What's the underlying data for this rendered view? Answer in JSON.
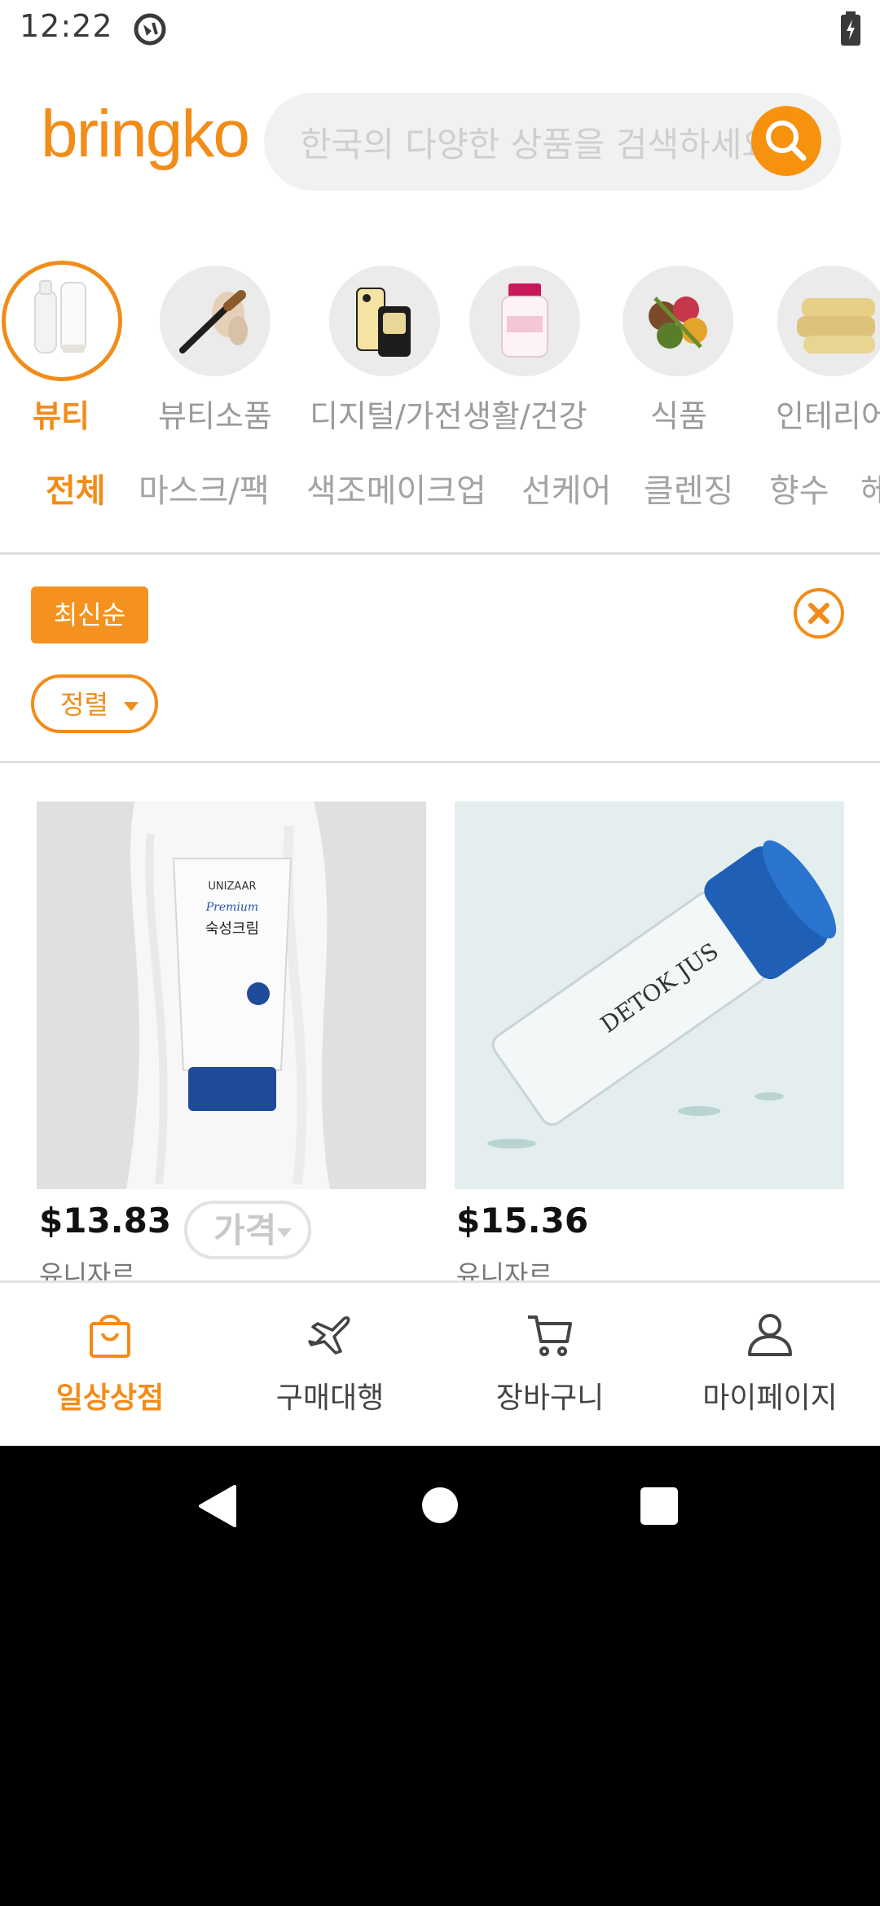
{
  "status": {
    "time": "12:22"
  },
  "header": {
    "logo": "bringko",
    "search_placeholder": "한국의 다양한 상품을 검색하세요"
  },
  "categories": [
    {
      "label": "뷰티",
      "active": true
    },
    {
      "label": "뷰티소품",
      "active": false
    },
    {
      "label": "디지털/가전",
      "active": false
    },
    {
      "label": "생활/건강",
      "active": false
    },
    {
      "label": "식품",
      "active": false
    },
    {
      "label": "인테리어",
      "active": false
    }
  ],
  "subcategories": [
    "전체",
    "마스크/팩",
    "색조메이크업",
    "선케어",
    "클렌징",
    "향수",
    "헤"
  ],
  "filters": {
    "active_sort": "최신순",
    "sort_chip": "정렬",
    "price_chip": "가격"
  },
  "products": [
    {
      "price": "$13.83",
      "brand": "유니자르",
      "image_text_brand": "UNIZAAR",
      "image_text_line": "Premium",
      "image_text_name": "숙성크림"
    },
    {
      "price": "$15.36",
      "brand": "유니자르",
      "image_text_name": "DETOK JUS"
    }
  ],
  "bottom_nav": [
    {
      "label": "일상상점",
      "icon": "shopping-bag-icon",
      "active": true
    },
    {
      "label": "구매대행",
      "icon": "airplane-icon",
      "active": false
    },
    {
      "label": "장바구니",
      "icon": "cart-icon",
      "active": false
    },
    {
      "label": "마이페이지",
      "icon": "user-icon",
      "active": false
    }
  ],
  "colors": {
    "accent": "#f28c18",
    "muted": "#a3a3a3"
  }
}
